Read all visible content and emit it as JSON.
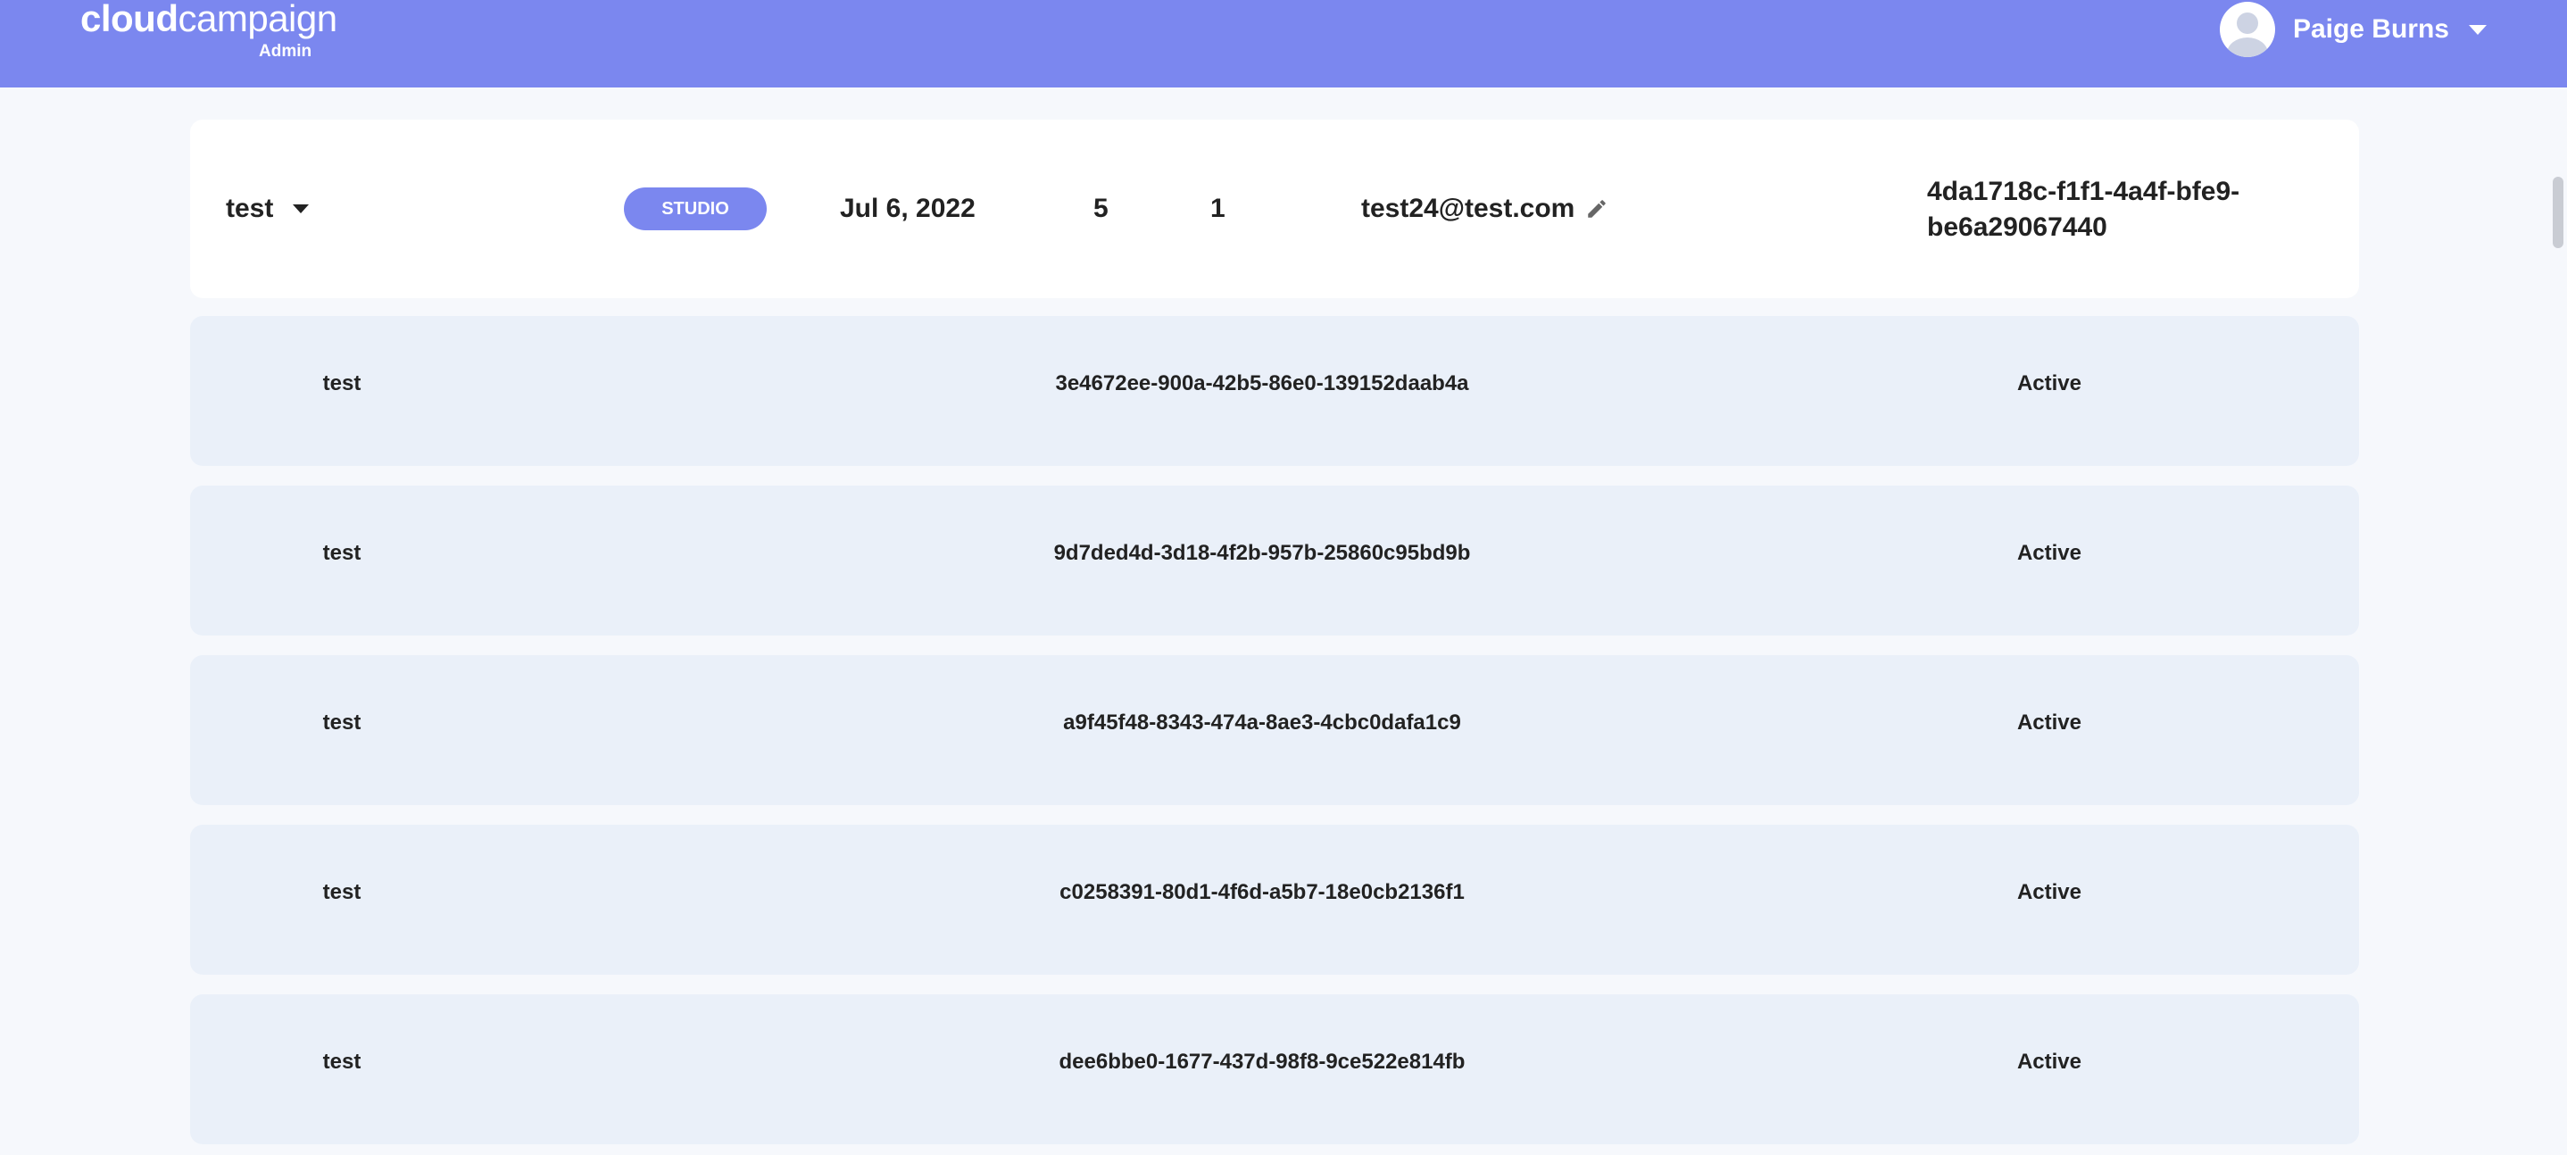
{
  "header": {
    "logo_main_bold": "cloud",
    "logo_main_rest": "campaign",
    "logo_sub": "Admin",
    "user_name": "Paige Burns",
    "brand_color": "#7b87ef"
  },
  "organization": {
    "name": "test",
    "plan_badge": "STUDIO",
    "date": "Jul 6, 2022",
    "count_a": "5",
    "count_b": "1",
    "email": "test24@test.com",
    "id": "4da1718c-f1f1-4a4f-bfe9-be6a29067440"
  },
  "sub_accounts": [
    {
      "name": "test",
      "id": "3e4672ee-900a-42b5-86e0-139152daab4a",
      "status": "Active"
    },
    {
      "name": "test",
      "id": "9d7ded4d-3d18-4f2b-957b-25860c95bd9b",
      "status": "Active"
    },
    {
      "name": "test",
      "id": "a9f45f48-8343-474a-8ae3-4cbc0dafa1c9",
      "status": "Active"
    },
    {
      "name": "test",
      "id": "c0258391-80d1-4f6d-a5b7-18e0cb2136f1",
      "status": "Active"
    },
    {
      "name": "test",
      "id": "dee6bbe0-1677-437d-98f8-9ce522e814fb",
      "status": "Active"
    }
  ]
}
